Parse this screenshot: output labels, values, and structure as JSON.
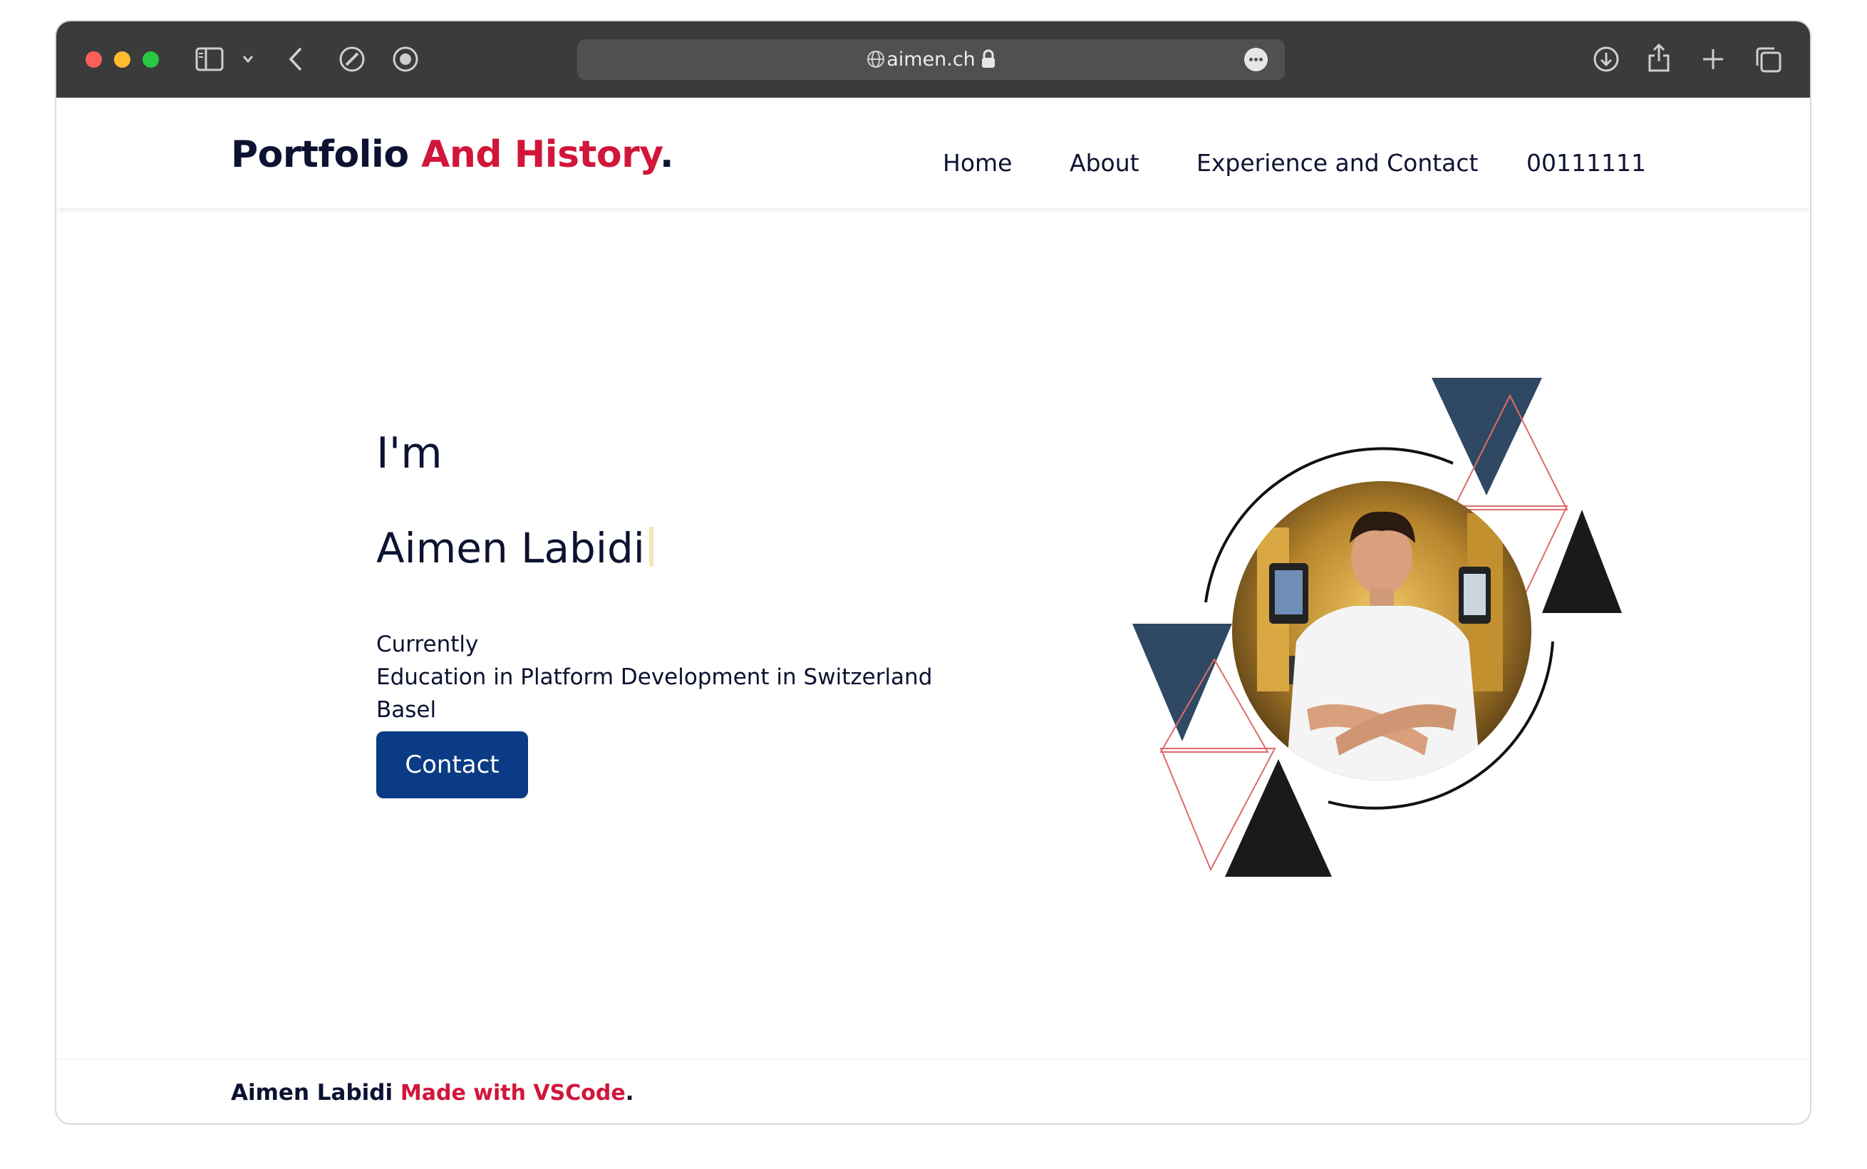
{
  "browser": {
    "url": "aimen.ch",
    "icons": [
      "sidebar-icon",
      "chevron-down-icon",
      "back-icon",
      "compass-icon",
      "play-circle-icon",
      "globe-icon",
      "lock-icon",
      "more-icon",
      "download-icon",
      "share-icon",
      "plus-icon",
      "tabs-icon"
    ]
  },
  "header": {
    "logo_main": "Portfolio",
    "logo_accent": "And History",
    "logo_dot": ".",
    "nav": [
      "Home",
      "About",
      "Experience and Contact",
      "00111111"
    ]
  },
  "hero": {
    "intro": "I'm",
    "name": "Aimen Labidi",
    "lines": [
      "Currently",
      "Education in Platform Development in Switzerland",
      "Basel"
    ],
    "button_label": "Contact"
  },
  "footer": {
    "author": "Aimen Labidi",
    "made_with": "Made with VSCode",
    "dot": "."
  },
  "colors": {
    "accent": "#d1163a",
    "text": "#0c1230",
    "button": "#0b3b85",
    "triangle_navy": "#2f4863",
    "triangle_black": "#1a1a1a"
  }
}
